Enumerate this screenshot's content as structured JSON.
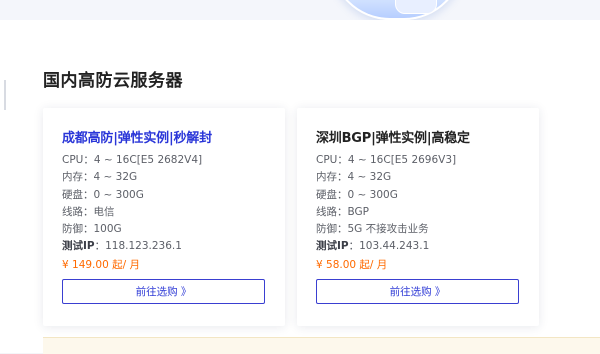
{
  "page": {
    "title": "国内高防云服务器"
  },
  "cards": [
    {
      "title": "成都高防|弹性实例|秒解封",
      "cpu": "CPU：4 ~ 16C[E5 2682V4]",
      "mem": "内存：4 ~ 32G",
      "disk": "硬盘：0 ~ 300G",
      "line": "线路：电信",
      "defense": "防御：100G",
      "test_ip_label": "测试IP",
      "test_ip": "：118.123.236.1",
      "price": "¥ 149.00 起/ 月",
      "button": "前往选购 》"
    },
    {
      "title": "深圳BGP|弹性实例|高稳定",
      "cpu": "CPU：4 ~ 16C[E5 2696V3]",
      "mem": "内存：4 ~ 32G",
      "disk": "硬盘：0 ~ 300G",
      "line": "线路：BGP",
      "defense": "防御：5G 不接攻击业务",
      "test_ip_label": "测试IP",
      "test_ip": "：103.44.243.1",
      "price": "¥ 58.00 起/ 月",
      "button": "前往选购 》"
    }
  ],
  "watermark": "",
  "colors": {
    "accent": "#2a36d8",
    "price": "#ff6a00",
    "button_border": "#3a3fd1"
  }
}
